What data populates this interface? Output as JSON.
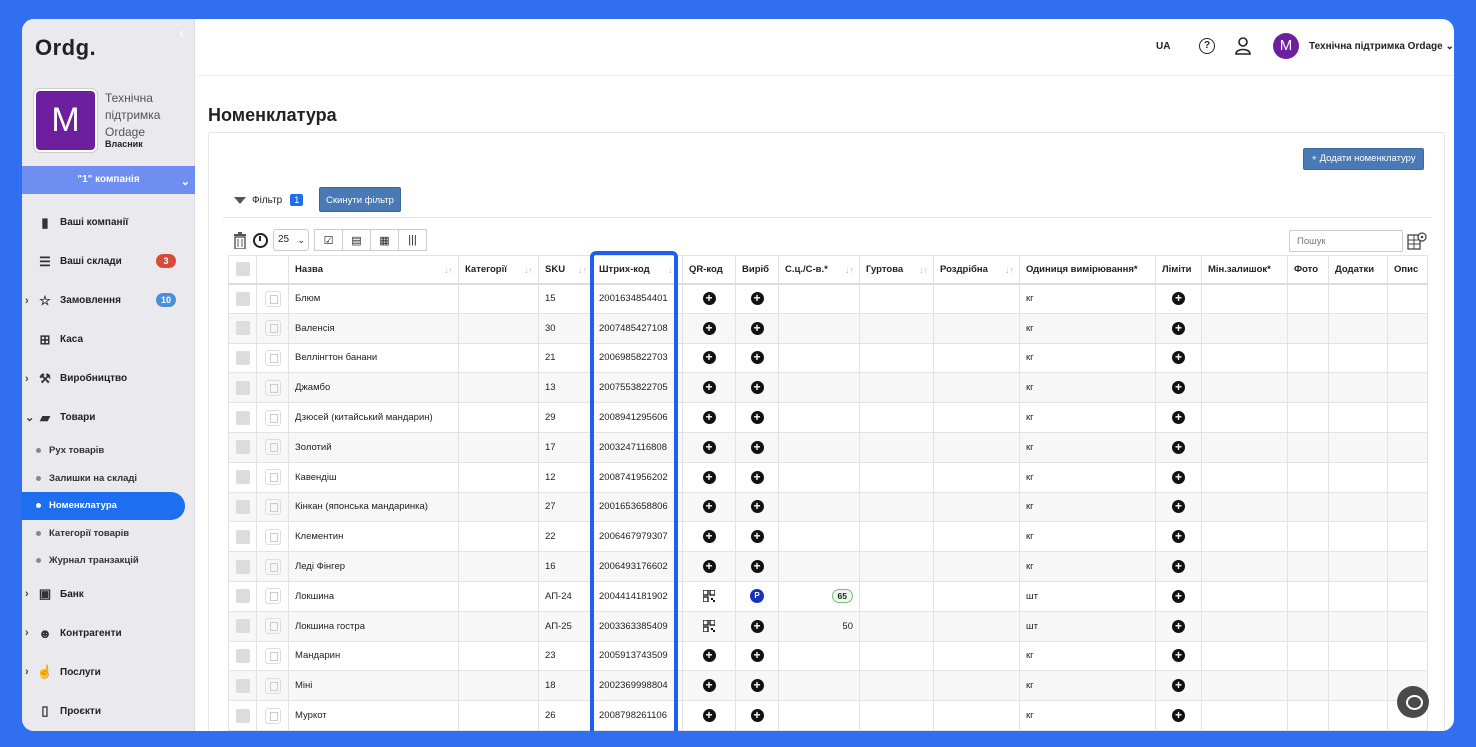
{
  "app": {
    "logo": "Ordg.",
    "collapse_icon": "chevron-left-icon"
  },
  "profile": {
    "initial": "M",
    "name": "Технічна підтримка Ordage",
    "role": "Власник"
  },
  "company": {
    "label": "\"1\" компанія"
  },
  "nav": [
    {
      "label": "Ваші компанії",
      "icon": "building-icon",
      "badge": ""
    },
    {
      "label": "Ваші склади",
      "icon": "list-icon",
      "badge": "3",
      "badge_color": "#d84a3a"
    },
    {
      "label": "Замовлення",
      "icon": "star-icon",
      "badge": "10",
      "badge_color": "#4a90d9"
    },
    {
      "label": "Каса",
      "icon": "basket-icon",
      "badge": ""
    },
    {
      "label": "Виробництво",
      "icon": "wand-icon",
      "badge": ""
    },
    {
      "label": "Товари",
      "icon": "box-icon",
      "badge": ""
    }
  ],
  "sub_nav": [
    "Рух товарів",
    "Залишки на складі",
    "Номенклатура",
    "Категорії товарів",
    "Журнал транзакцій"
  ],
  "nav2": [
    {
      "label": "Банк",
      "icon": "money-icon"
    },
    {
      "label": "Контрагенти",
      "icon": "users-icon"
    },
    {
      "label": "Послуги",
      "icon": "thumbs-up-icon"
    },
    {
      "label": "Проєкти",
      "icon": "file-icon"
    }
  ],
  "topbar": {
    "lang": "UA",
    "user": "Технічна підтримка Ordage",
    "avatar_initial": "M"
  },
  "page": {
    "title": "Номенклатура",
    "add_button": "+ Додати номенклатуру",
    "filter_label": "Фільтр",
    "filter_count": "1",
    "reset_button": "Скинути фільтр",
    "per_page": "25",
    "search_placeholder": "Пошук"
  },
  "columns": [
    "Назва",
    "Категорії",
    "SKU",
    "Штрих-код",
    "QR-код",
    "Виріб",
    "С.ц./С-в.*",
    "Гуртова",
    "Роздрібна",
    "Одиниця вимірювання*",
    "Ліміти",
    "Мін.залишок*",
    "Фото",
    "Додатки",
    "Опис"
  ],
  "rows": [
    {
      "name": "Блюм",
      "sku": "15",
      "barcode": "2001634854401",
      "qr": "plus",
      "product": "plus",
      "cost": "",
      "unit": "кг"
    },
    {
      "name": "Валенсія",
      "sku": "30",
      "barcode": "2007485427108",
      "qr": "plus",
      "product": "plus",
      "cost": "",
      "unit": "кг"
    },
    {
      "name": "Веллінгтон банани",
      "sku": "21",
      "barcode": "2006985822703",
      "qr": "plus",
      "product": "plus",
      "cost": "",
      "unit": "кг"
    },
    {
      "name": "Джамбо",
      "sku": "13",
      "barcode": "2007553822705",
      "qr": "plus",
      "product": "plus",
      "cost": "",
      "unit": "кг"
    },
    {
      "name": "Дзюсей (китайський мандарин)",
      "sku": "29",
      "barcode": "2008941295606",
      "qr": "plus",
      "product": "plus",
      "cost": "",
      "unit": "кг"
    },
    {
      "name": "Золотий",
      "sku": "17",
      "barcode": "2003247116808",
      "qr": "plus",
      "product": "plus",
      "cost": "",
      "unit": "кг"
    },
    {
      "name": "Кавендіш",
      "sku": "12",
      "barcode": "2008741956202",
      "qr": "plus",
      "product": "plus",
      "cost": "",
      "unit": "кг"
    },
    {
      "name": "Кінкан (японська мандаринка)",
      "sku": "27",
      "barcode": "2001653658806",
      "qr": "plus",
      "product": "plus",
      "cost": "",
      "unit": "кг"
    },
    {
      "name": "Клементин",
      "sku": "22",
      "barcode": "2006467979307",
      "qr": "plus",
      "product": "plus",
      "cost": "",
      "unit": "кг"
    },
    {
      "name": "Леді Фінгер",
      "sku": "16",
      "barcode": "2006493176602",
      "qr": "plus",
      "product": "plus",
      "cost": "",
      "unit": "кг"
    },
    {
      "name": "Локшина",
      "sku": "АП-24",
      "barcode": "2004414181902",
      "qr": "qr",
      "product": "p",
      "cost": "65",
      "unit": "шт"
    },
    {
      "name": "Локшина гостра",
      "sku": "АП-25",
      "barcode": "2003363385409",
      "qr": "qr",
      "product": "plus",
      "cost": "50",
      "unit": "шт"
    },
    {
      "name": "Мандарин",
      "sku": "23",
      "barcode": "2005913743509",
      "qr": "plus",
      "product": "plus",
      "cost": "",
      "unit": "кг"
    },
    {
      "name": "Міні",
      "sku": "18",
      "barcode": "2002369998804",
      "qr": "plus",
      "product": "plus",
      "cost": "",
      "unit": "кг"
    },
    {
      "name": "Муркот",
      "sku": "26",
      "barcode": "2008798261106",
      "qr": "plus",
      "product": "plus",
      "cost": "",
      "unit": "кг"
    }
  ],
  "colors": {
    "brand": "#6d1f9e",
    "accent": "#1e6ff0",
    "button": "#4a7ab5"
  }
}
